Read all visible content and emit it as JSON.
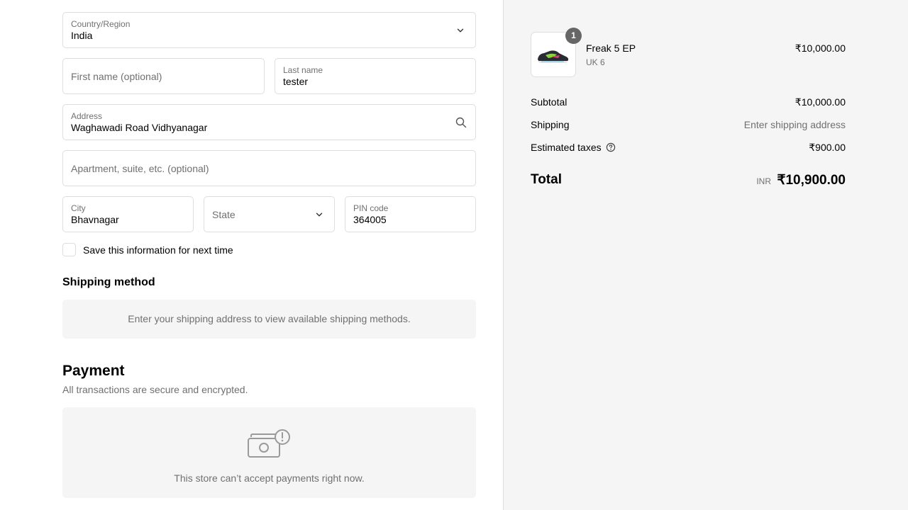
{
  "address_form": {
    "country": {
      "label": "Country/Region",
      "value": "India"
    },
    "first_name": {
      "placeholder": "First name (optional)"
    },
    "last_name": {
      "label": "Last name",
      "value": "tester"
    },
    "address": {
      "label": "Address",
      "value": "Waghawadi Road Vidhyanagar"
    },
    "apartment": {
      "placeholder": "Apartment, suite, etc. (optional)"
    },
    "city": {
      "label": "City",
      "value": "Bhavnagar"
    },
    "state": {
      "placeholder": "State"
    },
    "pin": {
      "label": "PIN code",
      "value": "364005"
    },
    "save_info": {
      "label": "Save this information for next time",
      "checked": false
    }
  },
  "shipping_method": {
    "heading": "Shipping method",
    "message": "Enter your shipping address to view available shipping methods."
  },
  "payment": {
    "heading": "Payment",
    "subtitle": "All transactions are secure and encrypted.",
    "icon": "cash-warning-icon",
    "message": "This store can’t accept payments right now."
  },
  "order_summary": {
    "item": {
      "name": "Freak 5 EP",
      "variant": "UK 6",
      "price": "₹10,000.00",
      "quantity": "1"
    },
    "subtotal": {
      "label": "Subtotal",
      "value": "₹10,000.00"
    },
    "shipping": {
      "label": "Shipping",
      "value": "Enter shipping address"
    },
    "taxes": {
      "label": "Estimated taxes",
      "value": "₹900.00"
    },
    "total": {
      "label": "Total",
      "currency": "INR",
      "value": "₹10,900.00"
    }
  },
  "colors": {
    "border": "#dedede",
    "muted_text": "#707070",
    "panel_bg": "#f5f5f5",
    "badge_bg": "#666666"
  }
}
